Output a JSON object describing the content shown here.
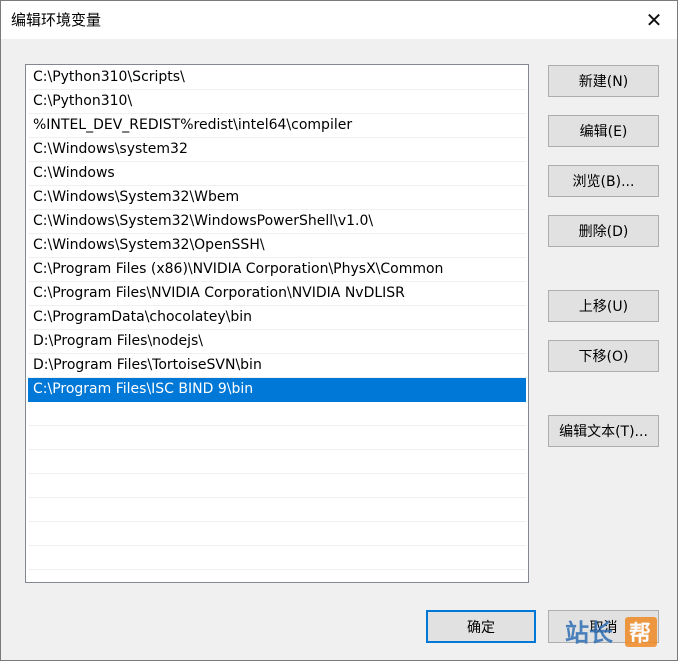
{
  "window": {
    "title": "编辑环境变量",
    "close_glyph": "✕"
  },
  "list": {
    "items": [
      "C:\\Python310\\Scripts\\",
      "C:\\Python310\\",
      "%INTEL_DEV_REDIST%redist\\intel64\\compiler",
      "C:\\Windows\\system32",
      "C:\\Windows",
      "C:\\Windows\\System32\\Wbem",
      "C:\\Windows\\System32\\WindowsPowerShell\\v1.0\\",
      "C:\\Windows\\System32\\OpenSSH\\",
      "C:\\Program Files (x86)\\NVIDIA Corporation\\PhysX\\Common",
      "C:\\Program Files\\NVIDIA Corporation\\NVIDIA NvDLISR",
      "C:\\ProgramData\\chocolatey\\bin",
      "D:\\Program Files\\nodejs\\",
      "D:\\Program Files\\TortoiseSVN\\bin",
      "C:\\Program Files\\ISC BIND 9\\bin"
    ],
    "selected_index": 13,
    "selected_color": "#0078d7"
  },
  "buttons": {
    "new": "新建(N)",
    "edit": "编辑(E)",
    "browse": "浏览(B)...",
    "delete": "删除(D)",
    "move_up": "上移(U)",
    "move_down": "下移(O)",
    "edit_text": "编辑文本(T)...",
    "ok": "确定",
    "cancel": "取消"
  },
  "watermark": {
    "text": "站长帮"
  }
}
